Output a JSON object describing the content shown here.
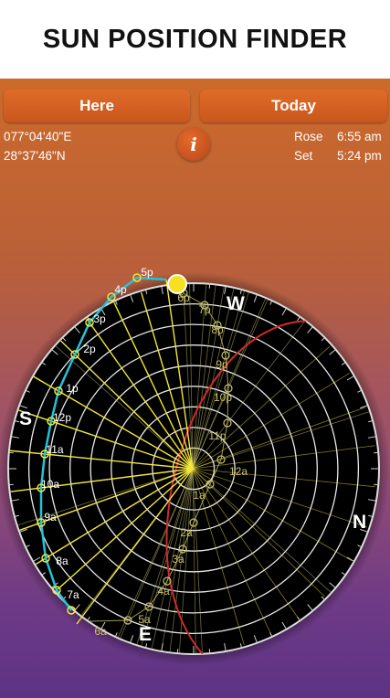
{
  "banner": {
    "title": "SUN POSITION FINDER"
  },
  "buttons": {
    "here": "Here",
    "today": "Today"
  },
  "info_icon": {
    "glyph": "i"
  },
  "location": {
    "longitude": "077°04'40\"E",
    "latitude": "28°37'46\"N"
  },
  "sun_times": {
    "rose_label": "Rose",
    "rose_time": "6:55 am",
    "set_label": "Set",
    "set_time": "5:24 pm"
  },
  "compass": {
    "west": "W",
    "south": "S",
    "north": "N",
    "east": "E"
  },
  "sun_path_hours": [
    "7a",
    "8a",
    "9a",
    "10a",
    "11a",
    "12p",
    "1p",
    "2p",
    "3p",
    "4p",
    "5p"
  ],
  "night_path_hours": [
    "6p",
    "7p",
    "8p",
    "9p",
    "10p",
    "11p",
    "12a",
    "1a",
    "2a",
    "3a",
    "4a",
    "5a",
    "6a"
  ],
  "colors": {
    "sun_path": "#22c4d8",
    "hour_lines": "#f2e63a",
    "night_lines": "#c9c26a",
    "night_path": "#d12a2a",
    "sun": "#f6e020"
  }
}
